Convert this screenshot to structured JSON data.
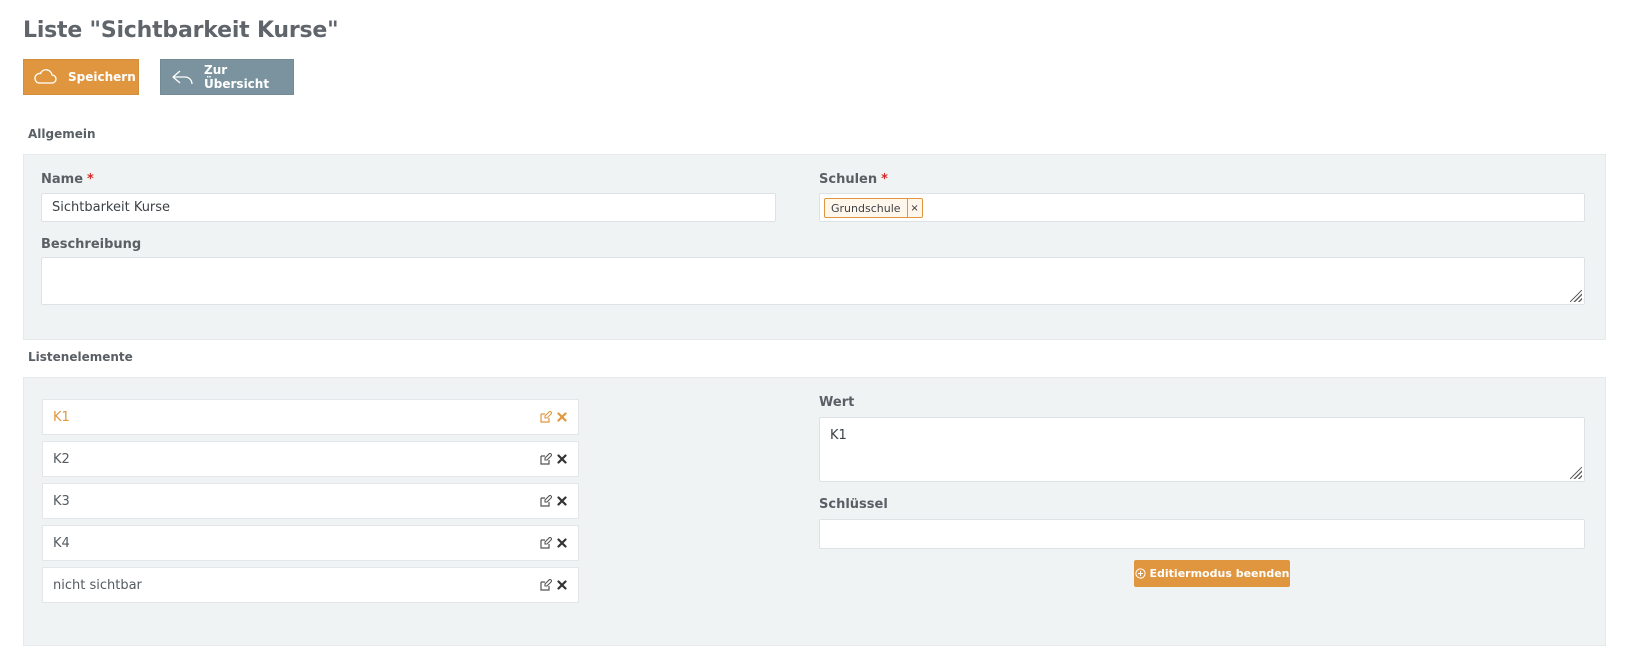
{
  "page": {
    "title": "Liste \"Sichtbarkeit Kurse\""
  },
  "toolbar": {
    "save_label": "Speichern",
    "back_label": "Zur Übersicht"
  },
  "general": {
    "section_label": "Allgemein",
    "name": {
      "label": "Name",
      "required_mark": "*",
      "value": "Sichtbarkeit Kurse"
    },
    "schools": {
      "label": "Schulen",
      "required_mark": "*",
      "tags": [
        "Grundschule"
      ],
      "remove_symbol": "×"
    },
    "description": {
      "label": "Beschreibung",
      "value": ""
    }
  },
  "list_elements": {
    "section_label": "Listenelemente",
    "items": [
      {
        "label": "K1",
        "active": true
      },
      {
        "label": "K2",
        "active": false
      },
      {
        "label": "K3",
        "active": false
      },
      {
        "label": "K4",
        "active": false
      },
      {
        "label": "nicht sichtbar",
        "active": false
      }
    ],
    "value_field": {
      "label": "Wert",
      "value": "K1"
    },
    "key_field": {
      "label": "Schlüssel",
      "value": ""
    },
    "end_edit_label": "Editiermodus beenden"
  },
  "colors": {
    "accent": "#e0963f",
    "secondary": "#7a939e",
    "panel_bg": "#f0f3f4",
    "required": "#d62b2b"
  },
  "icons": {
    "save": "cloud-icon",
    "back": "reply-icon",
    "edit": "edit-icon",
    "delete": "close-icon",
    "end_edit": "circle-plus-icon"
  }
}
